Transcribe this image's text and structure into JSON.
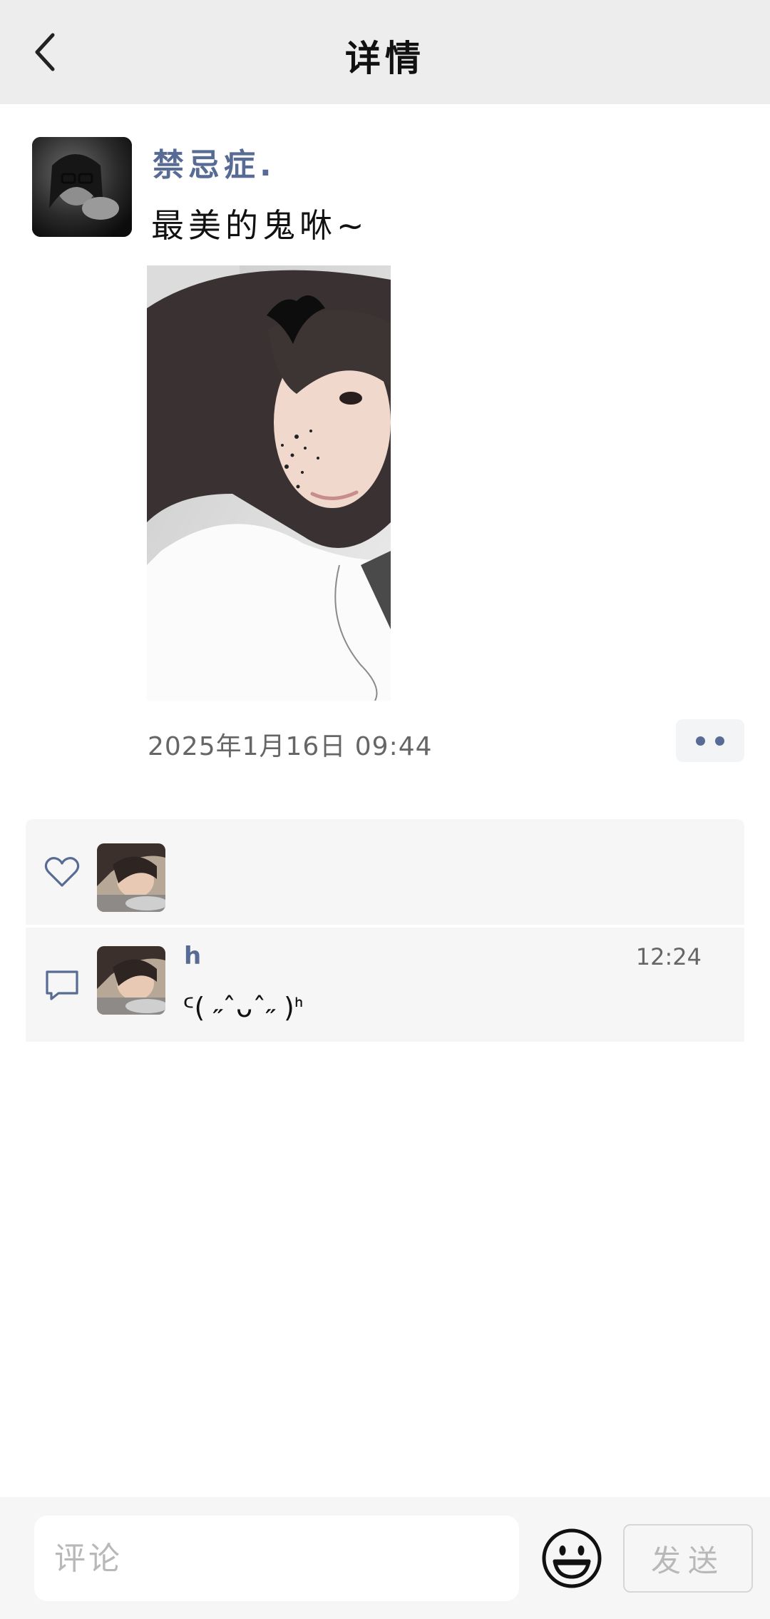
{
  "header": {
    "title": "详情",
    "back_icon": "chevron-left-icon"
  },
  "post": {
    "author": "禁忌症.",
    "text": "最美的鬼咻~",
    "timestamp": "2025年1月16日 09:44"
  },
  "likes": {
    "icon": "heart-outline-icon"
  },
  "comments": [
    {
      "author": "h",
      "time": "12:24",
      "text": "ᑦ( ˶ˆᴗˆ˶ )ᑋ"
    }
  ],
  "composer": {
    "placeholder": "评论",
    "emoji_icon": "smiley-face-icon",
    "send_label": "发送"
  },
  "colors": {
    "header_bg": "#ededed",
    "link_blue": "#576b95",
    "panel_bg": "#f6f6f6"
  }
}
